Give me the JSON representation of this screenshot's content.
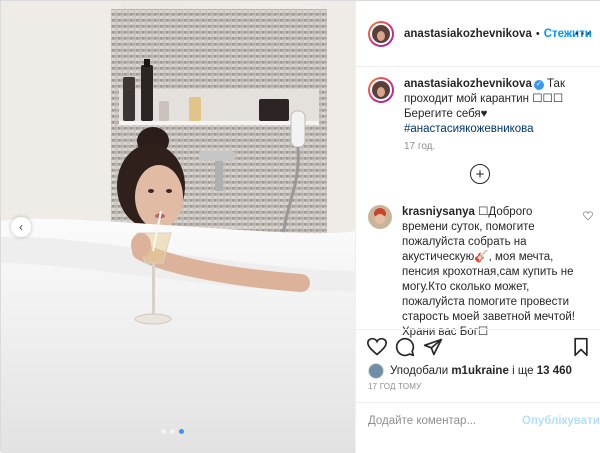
{
  "post": {
    "image_alt": "",
    "carousel": {
      "total": 3,
      "active_index": 2
    },
    "prev_arrow": "‹"
  },
  "header": {
    "username": "anastasiakozhevnikova",
    "separator": "•",
    "follow_label": "Стежити",
    "more_label": "···"
  },
  "caption": {
    "username": "anastasiakozhevnikova",
    "verified_mark": "✓",
    "text": "Так проходит мой карантин ☐☐☐ Берегите себя♥",
    "hashtag": "#анастасиякожевникова",
    "time": "17 год."
  },
  "load_more_label": "+",
  "comments": [
    {
      "username": "krasniysanya",
      "text": "☐Доброго времени суток, помогите пожалуйста собрать на акустическую🎸, моя мечта, пенсия крохотная,сам купить не могу.Кто сколько может, пожалуйста помогите провести старость моей заветной мечтой!Храни вас Бог☐"
    }
  ],
  "likes": {
    "prefix": "Уподобали",
    "user": "m1ukraine",
    "suffix": "і ще",
    "count": "13 460"
  },
  "post_time": "17 ГОД ТОМУ",
  "add_comment": {
    "placeholder": "Додайте коментар...",
    "publish_label": "Опублікувати"
  },
  "colors": {
    "link_blue": "#0095f6",
    "hashtag_blue": "#00376b",
    "publish_disabled": "#b2dffc",
    "muted_text": "#8e8e8e",
    "border": "#efefef"
  },
  "icons": [
    "heart-icon",
    "comment-icon",
    "share-icon",
    "bookmark-icon",
    "more-options-icon",
    "plus-circle-icon",
    "chevron-left-icon"
  ]
}
